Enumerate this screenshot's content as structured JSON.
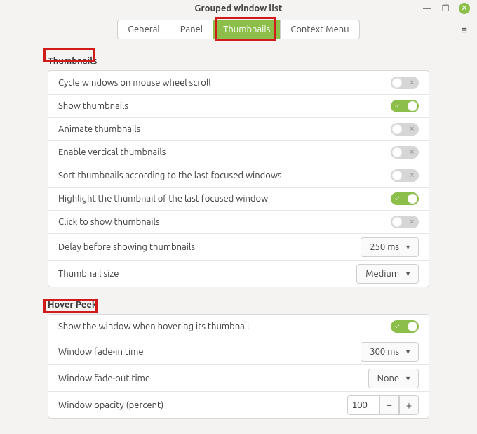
{
  "window": {
    "title": "Grouped window list"
  },
  "tabs": {
    "items": [
      {
        "label": "General"
      },
      {
        "label": "Panel"
      },
      {
        "label": "Thumbnails",
        "active": true
      },
      {
        "label": "Context Menu"
      }
    ]
  },
  "sections": {
    "thumbnails": {
      "title": "Thumbnails",
      "rows": {
        "cycle": {
          "label": "Cycle windows on mouse wheel scroll",
          "on": false
        },
        "show": {
          "label": "Show thumbnails",
          "on": true
        },
        "animate": {
          "label": "Animate thumbnails",
          "on": false
        },
        "vertical": {
          "label": "Enable vertical thumbnails",
          "on": false
        },
        "sort": {
          "label": "Sort thumbnails according to the last focused windows",
          "on": false
        },
        "highlight": {
          "label": "Highlight the thumbnail of the last focused window",
          "on": true
        },
        "click": {
          "label": "Click to show thumbnails",
          "on": false
        },
        "delay": {
          "label": "Delay before showing thumbnails",
          "value": "250 ms"
        },
        "size": {
          "label": "Thumbnail size",
          "value": "Medium"
        }
      }
    },
    "hoverpeek": {
      "title": "Hover Peek",
      "rows": {
        "show": {
          "label": "Show the window when hovering its thumbnail",
          "on": true
        },
        "fadein": {
          "label": "Window fade-in time",
          "value": "300 ms"
        },
        "fadeout": {
          "label": "Window fade-out time",
          "value": "None"
        },
        "opacity": {
          "label": "Window opacity (percent)",
          "value": "100"
        }
      }
    }
  },
  "glyphs": {
    "minimize": "—",
    "maximize": "❐",
    "close": "✕",
    "menu": "≡",
    "caret": "▼",
    "check": "✓",
    "cross": "✕",
    "minus": "−",
    "plus": "+"
  }
}
